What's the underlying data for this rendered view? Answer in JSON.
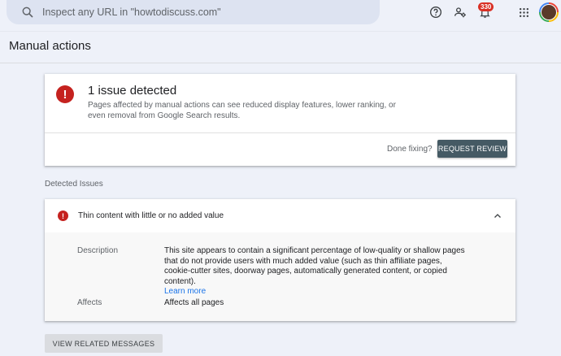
{
  "search": {
    "placeholder": "Inspect any URL in \"howtodiscuss.com\""
  },
  "topbar": {
    "notifications_count": "330"
  },
  "page": {
    "title": "Manual actions"
  },
  "issue_card": {
    "title": "1 issue detected",
    "description": "Pages affected by manual actions can see reduced display features, lower ranking, or even removal from Google Search results.",
    "done_text": "Done fixing?",
    "request_button": "REQUEST REVIEW"
  },
  "detected_issues": {
    "label": "Detected Issues",
    "item": {
      "title": "Thin content with little or no added value",
      "description_label": "Description",
      "description": "This site appears to contain a significant percentage of low-quality or shallow pages that do not provide users with much added value (such as thin affiliate pages, cookie-cutter sites, doorway pages, automatically generated content, or copied content).",
      "learn_more": "Learn more",
      "affects_label": "Affects",
      "affects_value": "Affects all pages"
    }
  },
  "view_related_button": "VIEW RELATED MESSAGES",
  "colors": {
    "error": "#c5221f",
    "button_dark": "#455a64",
    "link": "#1a73e8",
    "background": "#eef1f9"
  },
  "icons": [
    "search-icon",
    "help-icon",
    "manage-users-icon",
    "bell-icon",
    "apps-grid-icon",
    "error-icon",
    "chevron-up-icon"
  ]
}
